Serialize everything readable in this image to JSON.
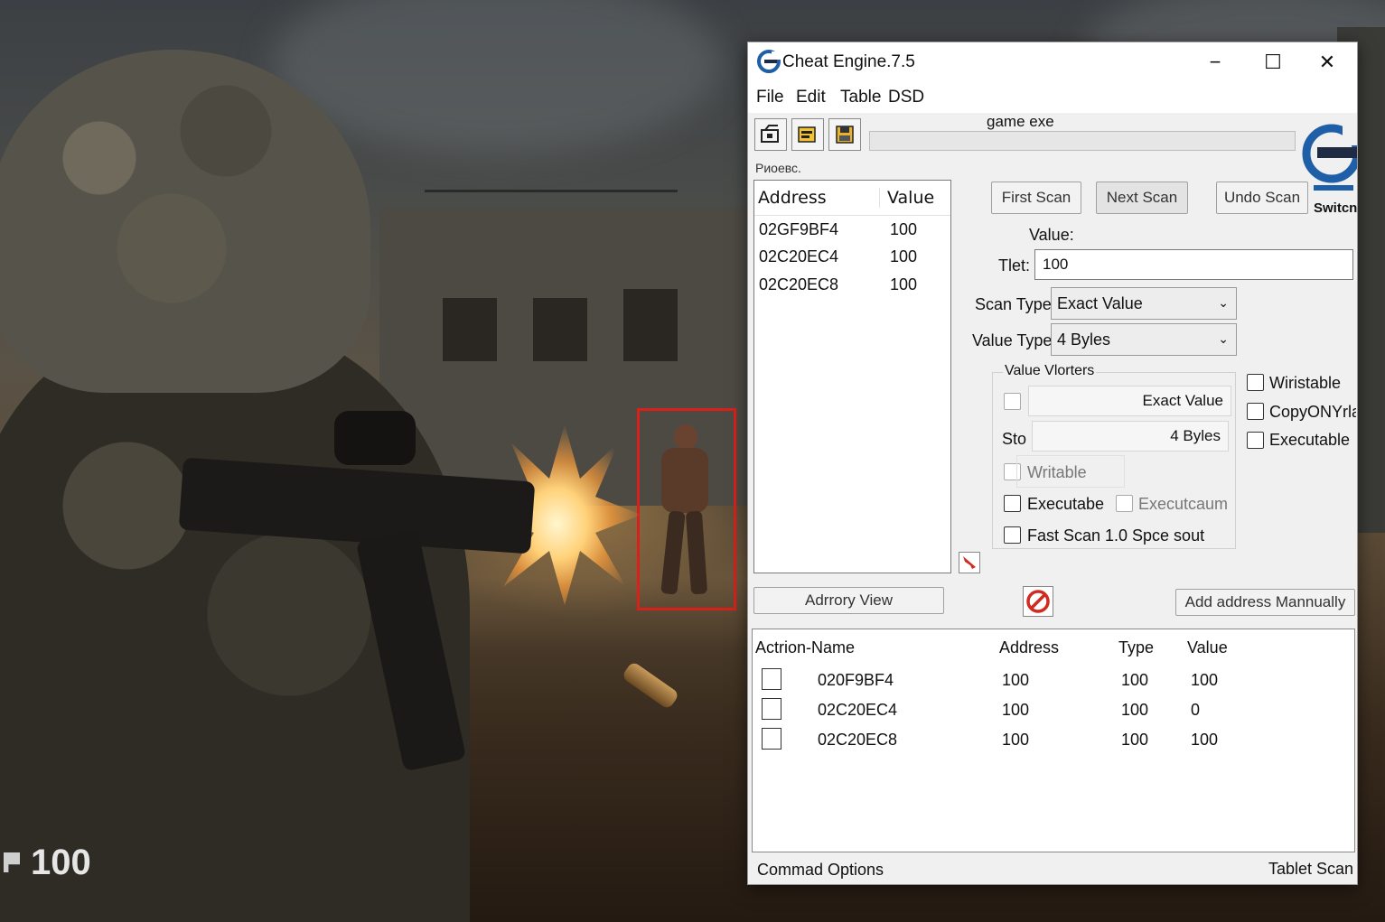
{
  "game": {
    "hud_health": "100"
  },
  "window": {
    "title": "Cheat Engine.7.5",
    "minimize_glyph": "−",
    "maximize_glyph": "☐",
    "close_glyph": "✕"
  },
  "menu": [
    "File",
    "Edit",
    "Table",
    "DSD"
  ],
  "toolbar": {
    "process_name": "game exe",
    "progress": 0,
    "process_status": "Риоевс.",
    "logo_caption": "Switcn"
  },
  "results": {
    "columns": [
      "Address",
      "Value"
    ],
    "rows": [
      {
        "address": "02GF9BF4",
        "value": "100"
      },
      {
        "address": "02C20EC4",
        "value": "100"
      },
      {
        "address": "02C20EC8",
        "value": "100"
      }
    ]
  },
  "scan_buttons": {
    "first": "First Scan",
    "next": "Next Scan",
    "undo": "Undo Scan"
  },
  "value_panel": {
    "value_label": "Value:",
    "tlet_label": "Tlet:",
    "tlet_value": "100",
    "scan_type_label": "Scan Type:",
    "scan_type_selected": "Exact Value",
    "value_type_label": "Value Type:",
    "value_type_selected": "4 Byles"
  },
  "value_vlorters": {
    "title": "Value Vlorters",
    "exact_value_field": "Exact Value",
    "sto_label": "Sto",
    "bytes_field": "4 Byles",
    "writable": "Writable",
    "executabe": "Executabe",
    "executcaum": "Executcaum",
    "fast_scan": "Fast Scan",
    "spce_sout": "1.0 Spce sout"
  },
  "memory_options": {
    "wiristable": "Wiristable",
    "copyonyrla": "CopyONYrla",
    "executable": "Executable"
  },
  "mid_buttons": {
    "memory_view": "Adrrory View",
    "add_manually": "Add address  Mannually"
  },
  "cheat_table": {
    "columns": [
      "Actrion-Name",
      "Address",
      "Type",
      "Value"
    ],
    "rows": [
      {
        "name": "020F9BF4",
        "address": "100",
        "type": "100",
        "value": "100"
      },
      {
        "name": "02C20EC4",
        "address": "100",
        "type": "100",
        "value": "0"
      },
      {
        "name": "02C20EC8",
        "address": "100",
        "type": "100",
        "value": "100"
      }
    ]
  },
  "status_bar": {
    "left": "Commad Options",
    "right": "Tablet Scan"
  },
  "colors": {
    "target_box": "#d9201a",
    "window_bg": "#f0f0f0",
    "logo_blue": "#1f5fa8"
  },
  "icons": {
    "app": "cheat-engine-logo-icon",
    "open_process": "open-process-icon",
    "open_file": "open-file-icon",
    "save": "save-icon",
    "pointer": "red-arrow-icon",
    "stop": "no-entry-icon"
  }
}
